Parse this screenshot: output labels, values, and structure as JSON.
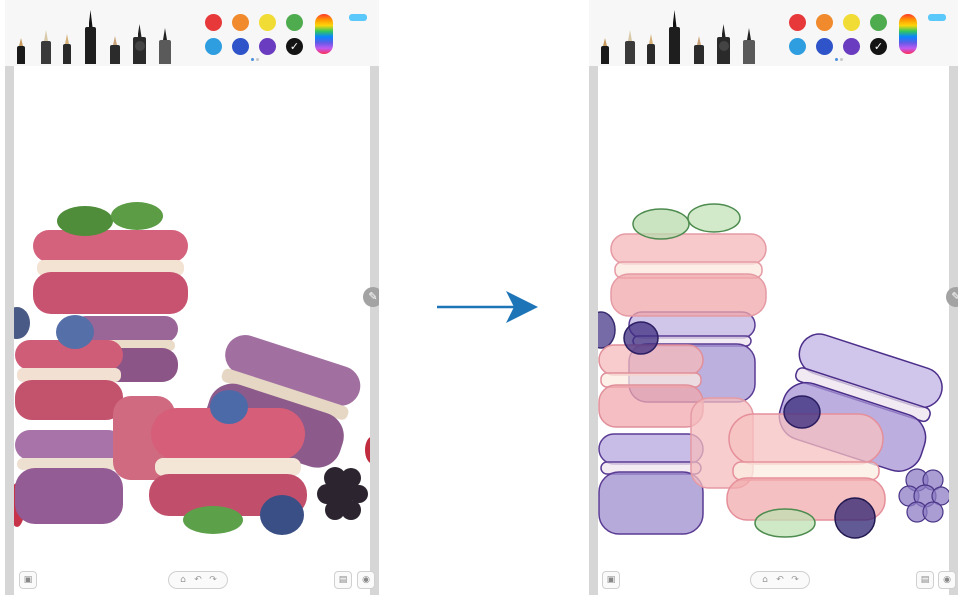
{
  "palette": {
    "row1": [
      {
        "name": "red",
        "hex": "#e8393a"
      },
      {
        "name": "orange",
        "hex": "#f08a2c"
      },
      {
        "name": "yellow",
        "hex": "#f1dc35"
      },
      {
        "name": "green",
        "hex": "#4eac4f"
      }
    ],
    "row2": [
      {
        "name": "light-blue",
        "hex": "#2f9ee0"
      },
      {
        "name": "blue",
        "hex": "#2f54c9"
      },
      {
        "name": "purple",
        "hex": "#6a3cc0"
      },
      {
        "name": "black",
        "hex": "#141414",
        "selected": true
      }
    ]
  },
  "pen_tools": [
    "fountain-pen-icon",
    "calligraphy-brush-icon",
    "pencil-icon",
    "marker-icon",
    "crayon-icon",
    "ink-pen-icon",
    "highlighter-icon"
  ],
  "icons": {
    "color_spectrum": "color-spectrum-icon",
    "selected_check": "✓",
    "side_handle": "pen-icon",
    "gallery": "gallery-icon",
    "home": "home-icon",
    "undo": "undo-icon",
    "redo": "redo-icon",
    "save": "save-icon",
    "share": "share-icon",
    "arrow": "right-arrow-icon"
  },
  "accent_color": "#1d74b6",
  "screens": [
    {
      "id": "left",
      "style": "photo"
    },
    {
      "id": "right",
      "style": "watercolor-drawing"
    }
  ]
}
